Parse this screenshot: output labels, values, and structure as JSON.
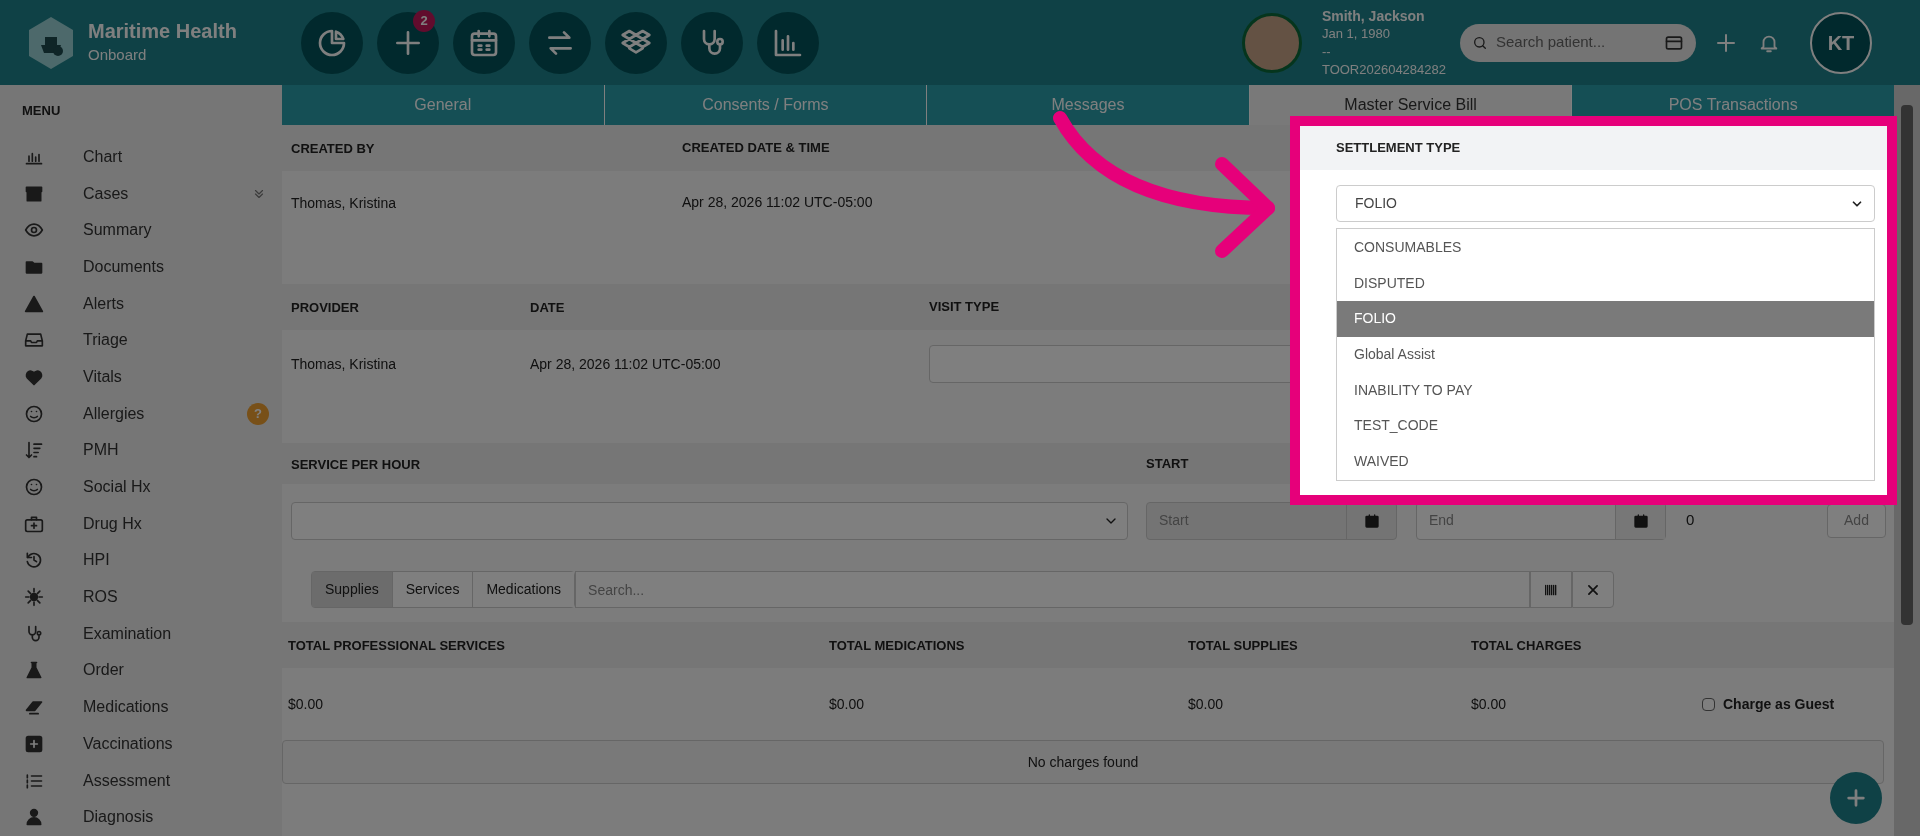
{
  "brand": {
    "name": "Maritime Health",
    "subtitle": "Onboard"
  },
  "toolbar": {
    "badge": "2"
  },
  "patient": {
    "name": "Smith, Jackson",
    "dob": "Jan 1, 1980",
    "line3": "--",
    "id": "TOOR202604284282"
  },
  "search": {
    "placeholder": "Search patient..."
  },
  "user": {
    "initials": "KT"
  },
  "sidebar": {
    "title": "MENU",
    "items": [
      {
        "label": "Chart",
        "kind": "plain"
      },
      {
        "label": "Cases",
        "kind": "collapsible"
      },
      {
        "label": "Summary",
        "kind": "plain"
      },
      {
        "label": "Documents",
        "kind": "plain"
      },
      {
        "label": "Alerts",
        "kind": "plain"
      },
      {
        "label": "Triage",
        "kind": "plain"
      },
      {
        "label": "Vitals",
        "kind": "plain"
      },
      {
        "label": "Allergies",
        "kind": "badge",
        "badge": "?"
      },
      {
        "label": "PMH",
        "kind": "plain"
      },
      {
        "label": "Social Hx",
        "kind": "plain"
      },
      {
        "label": "Drug Hx",
        "kind": "plain"
      },
      {
        "label": "HPI",
        "kind": "plain"
      },
      {
        "label": "ROS",
        "kind": "plain"
      },
      {
        "label": "Examination",
        "kind": "plain"
      },
      {
        "label": "Order",
        "kind": "plain"
      },
      {
        "label": "Medications",
        "kind": "plain"
      },
      {
        "label": "Vaccinations",
        "kind": "plain"
      },
      {
        "label": "Assessment",
        "kind": "plain"
      },
      {
        "label": "Diagnosis",
        "kind": "plain"
      }
    ]
  },
  "tabs": [
    {
      "label": "General",
      "selected": false
    },
    {
      "label": "Consents / Forms",
      "selected": false
    },
    {
      "label": "Messages",
      "selected": false
    },
    {
      "label": "Master Service Bill",
      "selected": true
    },
    {
      "label": "POS Transactions",
      "selected": false
    }
  ],
  "created": {
    "columns": [
      "CREATED BY",
      "CREATED DATE & TIME"
    ],
    "values": [
      "Thomas, Kristina",
      "Apr 28, 2026 11:02 UTC-05:00"
    ]
  },
  "visit": {
    "columns": [
      "PROVIDER",
      "DATE",
      "VISIT TYPE"
    ],
    "provider": "Thomas, Kristina",
    "date": "Apr 28, 2026 11:02 UTC-05:00"
  },
  "service": {
    "columns": [
      "SERVICE PER HOUR",
      "START"
    ],
    "start_placeholder": "Start",
    "end_placeholder": "End",
    "quantity": "0",
    "add": "Add"
  },
  "item_tabs": [
    {
      "label": "Supplies",
      "selected": true
    },
    {
      "label": "Services",
      "selected": false
    },
    {
      "label": "Medications",
      "selected": false
    }
  ],
  "item_search": {
    "placeholder": "Search..."
  },
  "totals": {
    "columns": [
      "TOTAL PROFESSIONAL SERVICES",
      "TOTAL MEDICATIONS",
      "TOTAL SUPPLIES",
      "TOTAL CHARGES"
    ],
    "values": [
      "$0.00",
      "$0.00",
      "$0.00",
      "$0.00"
    ],
    "charge_as_guest": {
      "label": "Charge as Guest",
      "checked": false
    }
  },
  "empty_message": "No charges found",
  "settlement": {
    "label": "SETTLEMENT TYPE",
    "value": "FOLIO",
    "options": [
      {
        "label": "CONSUMABLES",
        "selected": false
      },
      {
        "label": "DISPUTED",
        "selected": false
      },
      {
        "label": "FOLIO",
        "selected": true
      },
      {
        "label": "Global Assist",
        "selected": false
      },
      {
        "label": "INABILITY TO PAY",
        "selected": false
      },
      {
        "label": "TEST_CODE",
        "selected": false
      },
      {
        "label": "WAIVED",
        "selected": false
      }
    ]
  }
}
